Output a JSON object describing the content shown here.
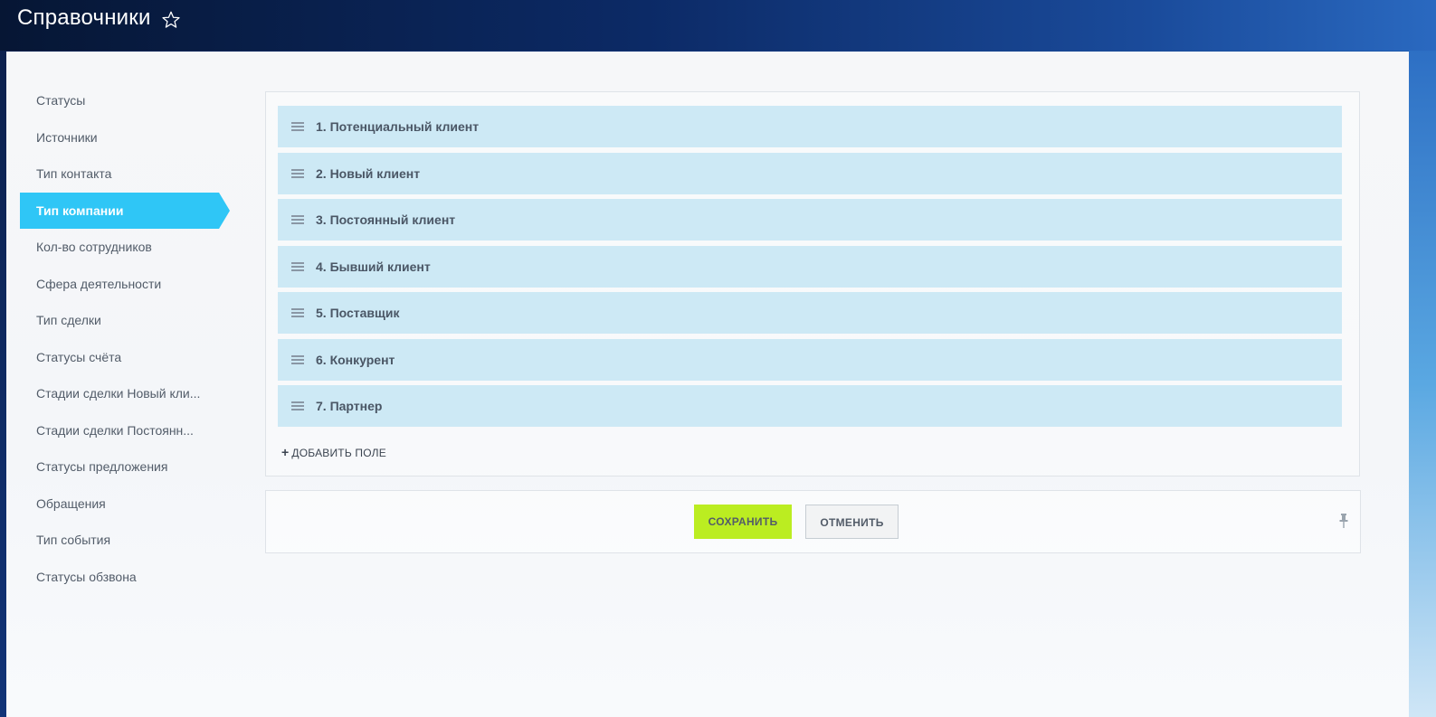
{
  "header": {
    "title": "Справочники",
    "star_icon": "star-icon"
  },
  "sidebar": {
    "items": [
      {
        "label": "Статусы"
      },
      {
        "label": "Источники"
      },
      {
        "label": "Тип контакта"
      },
      {
        "label": "Тип компании",
        "active": true
      },
      {
        "label": "Кол-во сотрудников"
      },
      {
        "label": "Сфера деятельности"
      },
      {
        "label": "Тип сделки"
      },
      {
        "label": "Статусы счёта"
      },
      {
        "label": "Стадии сделки Новый кли..."
      },
      {
        "label": "Стадии сделки Постоянн..."
      },
      {
        "label": "Статусы предложения"
      },
      {
        "label": "Обращения"
      },
      {
        "label": "Тип события"
      },
      {
        "label": "Статусы обзвона"
      }
    ]
  },
  "list": {
    "rows": [
      {
        "label": "1. Потенциальный клиент"
      },
      {
        "label": "2. Новый клиент"
      },
      {
        "label": "3. Постоянный клиент"
      },
      {
        "label": "4. Бывший клиент"
      },
      {
        "label": "5. Поставщик"
      },
      {
        "label": "6. Конкурент"
      },
      {
        "label": "7. Партнер"
      }
    ],
    "add_plus": "+",
    "add_label": "ДОБАВИТЬ ПОЛЕ"
  },
  "footer": {
    "save_label": "СОХРАНИТЬ",
    "cancel_label": "ОТМЕНИТЬ"
  },
  "colors": {
    "accent": "#2fc6f6",
    "row_bg": "#cde9f5",
    "save_bg": "#bbed21"
  }
}
